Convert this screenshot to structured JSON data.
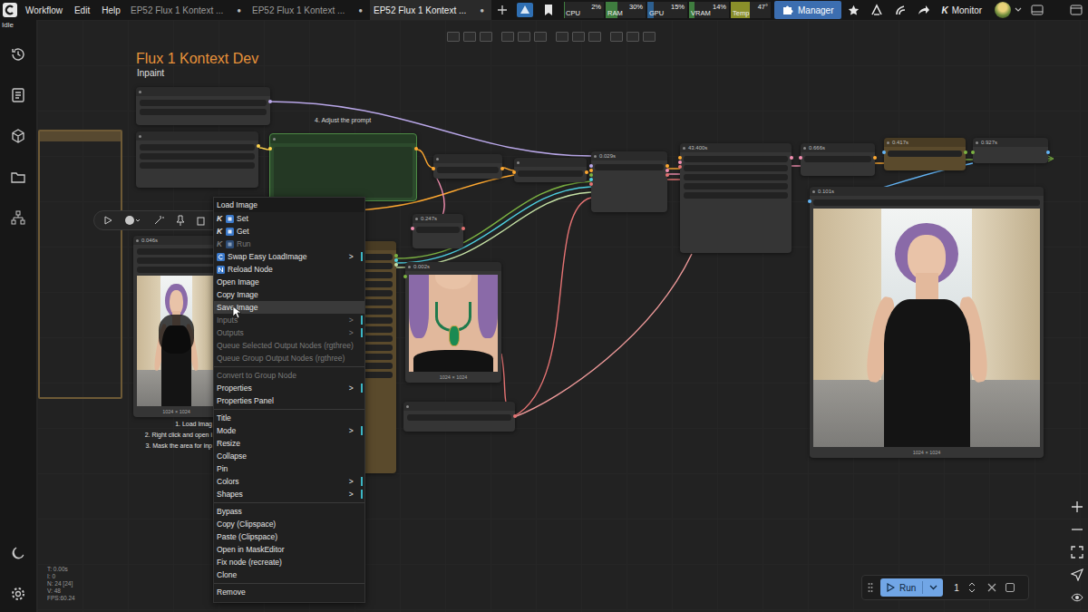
{
  "app": {
    "menus": [
      "Workflow",
      "Edit",
      "Help"
    ],
    "status": "Idle"
  },
  "tabs": [
    {
      "label": "EP52 Flux 1 Kontext ...",
      "selected": false,
      "unsaved": true
    },
    {
      "label": "EP52 Flux 1 Kontext ...",
      "selected": false,
      "unsaved": true
    },
    {
      "label": "EP52 Flux 1 Kontext ...",
      "selected": true,
      "unsaved": true
    }
  ],
  "unsaved_mark": "●",
  "meters": [
    {
      "name": "CPU",
      "reading": "2%",
      "level": 0.02,
      "color": "#3f7d3f"
    },
    {
      "name": "RAM",
      "reading": "30%",
      "level": 0.3,
      "color": "#3f7d3f"
    },
    {
      "name": "GPU",
      "reading": "15%",
      "level": 0.15,
      "color": "#2d5f8f"
    },
    {
      "name": "VRAM",
      "reading": "14%",
      "level": 0.14,
      "color": "#3f7d3f"
    },
    {
      "name": "Temp",
      "reading": "47°",
      "level": 0.47,
      "color": "#8a8f2a"
    }
  ],
  "manager": {
    "label": "Manager",
    "highlighted": true
  },
  "monitor": {
    "badge": "K",
    "label": "Monitor"
  },
  "canvas": {
    "title": "Flux 1 Kontext Dev",
    "subtitle": "Inpaint",
    "prompt_note": "4. Adjust the prompt",
    "steps": [
      "1. Load Imag",
      "2. Right click and open i",
      "3. Mask the area for inp"
    ],
    "frames": [
      {
        "color": "#6e5a36"
      }
    ],
    "nodes": [
      {
        "color": "#353535"
      },
      {
        "color": "#353535"
      },
      {
        "color": "#2c4a2c"
      },
      {
        "color": "#353535"
      },
      {
        "color": "#353535"
      },
      {
        "time": "0.029s",
        "color": "#353535"
      },
      {
        "time": "43.400s",
        "color": "#353535"
      },
      {
        "time": "0.666s",
        "color": "#353535"
      },
      {
        "time": "0.417s",
        "color": "#5a4a2c"
      },
      {
        "time": "0.927s",
        "color": "#353535"
      },
      {
        "time": "0.247s",
        "color": "#353535"
      },
      {
        "time": "0.002s",
        "color": "#353535",
        "size": "1024 × 1024"
      },
      {
        "color": "#353535"
      },
      {
        "time": "0.101s",
        "color": "#353535",
        "size": "1024 × 1024"
      },
      {
        "time": "0.046s",
        "color": "#353535",
        "size": "1024 × 1024"
      },
      {
        "color": "#5a4a2c"
      }
    ]
  },
  "context_menu": {
    "title": "Load Image",
    "submenu_mark": ">",
    "groups": [
      [
        {
          "label": "Set",
          "kind": "kj",
          "badge": "K",
          "disabled": false,
          "submenu": false,
          "hovered": false
        },
        {
          "label": "Get",
          "kind": "kj",
          "badge": "K",
          "disabled": false,
          "submenu": false,
          "hovered": false
        },
        {
          "label": "Run",
          "kind": "kj",
          "badge": "K",
          "disabled": true,
          "submenu": false,
          "hovered": false
        },
        {
          "label": "Swap Easy LoadImage",
          "kind": "easy",
          "disabled": false,
          "submenu": true,
          "hovered": false
        },
        {
          "label": "Reload Node",
          "kind": "reload",
          "disabled": false,
          "submenu": false,
          "hovered": false
        },
        {
          "label": "Open Image",
          "kind": "plain",
          "disabled": false,
          "submenu": false,
          "hovered": false
        },
        {
          "label": "Copy Image",
          "kind": "plain",
          "disabled": false,
          "submenu": false,
          "hovered": false
        },
        {
          "label": "Save Image",
          "kind": "plain",
          "disabled": false,
          "submenu": false,
          "hovered": true
        },
        {
          "label": "Inputs",
          "kind": "plain",
          "disabled": true,
          "submenu": true,
          "hovered": false
        },
        {
          "label": "Outputs",
          "kind": "plain",
          "disabled": true,
          "submenu": true,
          "hovered": false
        },
        {
          "label": "Queue Selected Output Nodes (rgthree)",
          "kind": "plain",
          "disabled": true,
          "submenu": false,
          "hovered": false
        },
        {
          "label": "Queue Group Output Nodes (rgthree)",
          "kind": "plain",
          "disabled": true,
          "submenu": false,
          "hovered": false
        }
      ],
      [
        {
          "label": "Convert to Group Node",
          "kind": "plain",
          "disabled": true,
          "submenu": false,
          "hovered": false
        },
        {
          "label": "Properties",
          "kind": "plain",
          "disabled": false,
          "submenu": true,
          "hovered": false
        },
        {
          "label": "Properties Panel",
          "kind": "plain",
          "disabled": false,
          "submenu": false,
          "hovered": false
        }
      ],
      [
        {
          "label": "Title",
          "kind": "plain",
          "disabled": false,
          "submenu": false,
          "hovered": false
        },
        {
          "label": "Mode",
          "kind": "plain",
          "disabled": false,
          "submenu": true,
          "hovered": false
        },
        {
          "label": "Resize",
          "kind": "plain",
          "disabled": false,
          "submenu": false,
          "hovered": false
        },
        {
          "label": "Collapse",
          "kind": "plain",
          "disabled": false,
          "submenu": false,
          "hovered": false
        },
        {
          "label": "Pin",
          "kind": "plain",
          "disabled": false,
          "submenu": false,
          "hovered": false
        },
        {
          "label": "Colors",
          "kind": "plain",
          "disabled": false,
          "submenu": true,
          "hovered": false
        },
        {
          "label": "Shapes",
          "kind": "plain",
          "disabled": false,
          "submenu": true,
          "hovered": false
        }
      ],
      [
        {
          "label": "Bypass",
          "kind": "plain",
          "disabled": false,
          "submenu": false,
          "hovered": false
        },
        {
          "label": "Copy (Clipspace)",
          "kind": "plain",
          "disabled": false,
          "submenu": false,
          "hovered": false
        },
        {
          "label": "Paste (Clipspace)",
          "kind": "plain",
          "disabled": false,
          "submenu": false,
          "hovered": false
        },
        {
          "label": "Open in MaskEditor",
          "kind": "plain",
          "disabled": false,
          "submenu": false,
          "hovered": false
        },
        {
          "label": "Fix node (recreate)",
          "kind": "plain",
          "disabled": false,
          "submenu": false,
          "hovered": false
        },
        {
          "label": "Clone",
          "kind": "plain",
          "disabled": false,
          "submenu": false,
          "hovered": false
        }
      ],
      [
        {
          "label": "Remove",
          "kind": "plain",
          "disabled": false,
          "submenu": false,
          "hovered": false
        }
      ]
    ]
  },
  "stats": [
    "T: 0.00s",
    "I: 0",
    "N: 24 [24]",
    "V: 48",
    "FPS:60.24"
  ],
  "run": {
    "label": "Run",
    "count": "1"
  }
}
